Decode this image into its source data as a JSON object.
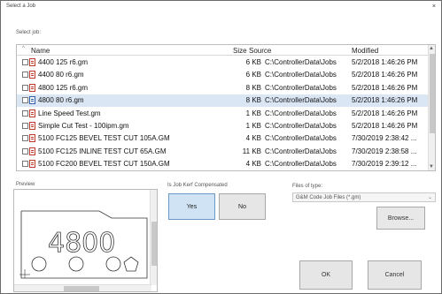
{
  "window": {
    "title": "Select a Job",
    "close_glyph": "×"
  },
  "labels": {
    "select_job": "Select job:",
    "preview": "Preview",
    "kerf": "Is Job Kerf Compensated",
    "files_of_type": "Files of type:"
  },
  "columns": {
    "name": "Name",
    "size": "Size",
    "source": "Source",
    "modified": "Modified",
    "sort_glyph": "^"
  },
  "files": [
    {
      "name": "4400 125 r6.gm",
      "size": "6 KB",
      "source": "C:\\ControllerData\\Jobs",
      "modified": "5/2/2018 1:46:26 PM",
      "icon": "gm-file-icon"
    },
    {
      "name": "4400 80 r6.gm",
      "size": "6 KB",
      "source": "C:\\ControllerData\\Jobs",
      "modified": "5/2/2018 1:46:26 PM",
      "icon": "gm-file-icon"
    },
    {
      "name": "4800 125 r6.gm",
      "size": "8 KB",
      "source": "C:\\ControllerData\\Jobs",
      "modified": "5/2/2018 1:46:26 PM",
      "icon": "gm-file-icon"
    },
    {
      "name": "4800 80 r6.gm",
      "size": "8 KB",
      "source": "C:\\ControllerData\\Jobs",
      "modified": "5/2/2018 1:46:26 PM",
      "icon": "gm-file-icon-selected"
    },
    {
      "name": "Line Speed Test.gm",
      "size": "1 KB",
      "source": "C:\\ControllerData\\Jobs",
      "modified": "5/2/2018 1:46:26 PM",
      "icon": "gm-file-icon"
    },
    {
      "name": "Simple Cut Test - 100ipm.gm",
      "size": "1 KB",
      "source": "C:\\ControllerData\\Jobs",
      "modified": "5/2/2018 1:46:26 PM",
      "icon": "gm-file-icon"
    },
    {
      "name": "5100 FC125 BEVEL TEST CUT 105A.GM",
      "size": "4 KB",
      "source": "C:\\ControllerData\\Jobs",
      "modified": "7/30/2019 2:38:42 ...",
      "icon": "gm-file-icon"
    },
    {
      "name": "5100 FC125 INLINE TEST CUT 65A.GM",
      "size": "11 KB",
      "source": "C:\\ControllerData\\Jobs",
      "modified": "7/30/2019 2:38:58 ...",
      "icon": "gm-file-icon"
    },
    {
      "name": "5100 FC200 BEVEL TEST CUT 150A.GM",
      "size": "4 KB",
      "source": "C:\\ControllerData\\Jobs",
      "modified": "7/30/2019 2:39:12 ...",
      "icon": "gm-file-icon"
    }
  ],
  "selected_index": 3,
  "kerf": {
    "yes_label": "Yes",
    "no_label": "No",
    "selected": "Yes"
  },
  "file_type": {
    "selected": "G&M Code Job Files (*.gm)",
    "arrow_glyph": "⌄"
  },
  "buttons": {
    "browse": "Browse...",
    "ok": "OK",
    "cancel": "Cancel"
  },
  "preview_shape": {
    "text": "4800",
    "holes": [
      "circle",
      "circle",
      "circle",
      "pentagon"
    ]
  },
  "colors": {
    "selection": "#dbe6f4",
    "accent_toggle": "#cfe3f4",
    "file_icon": "#c0392b"
  }
}
